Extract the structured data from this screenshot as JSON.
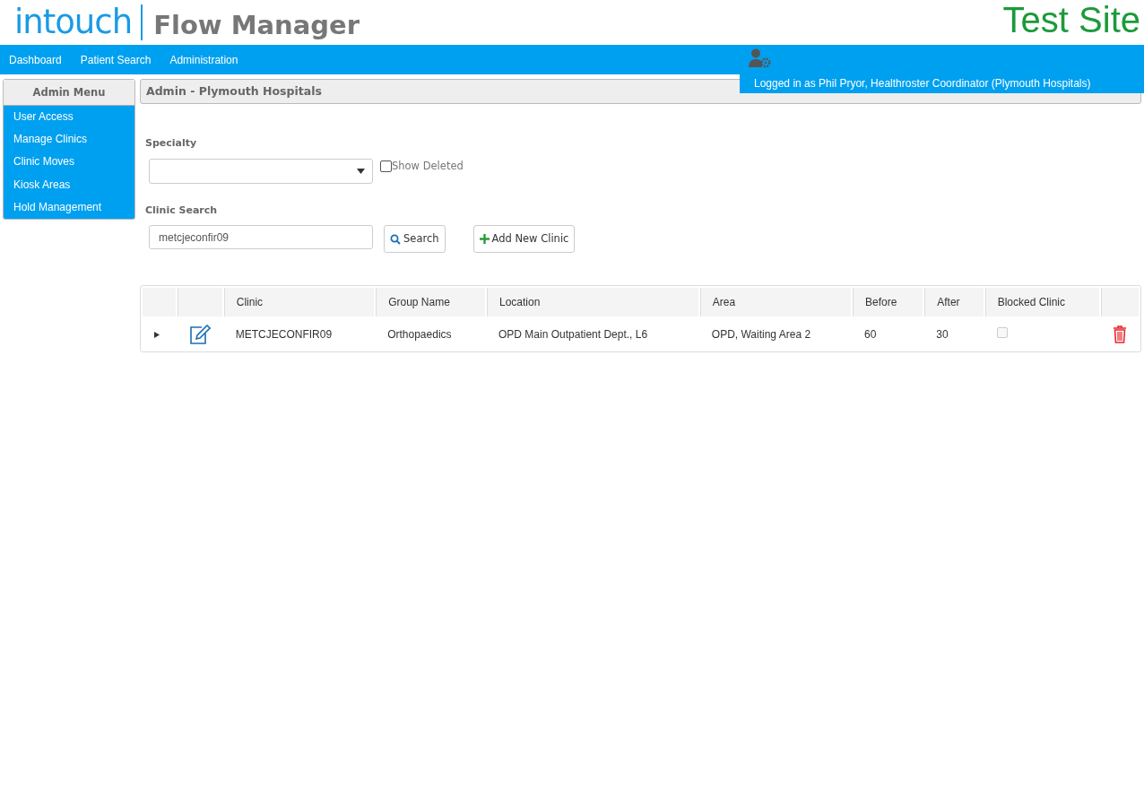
{
  "header": {
    "logo_primary": "intouch",
    "logo_secondary": "Flow Manager",
    "site_label": "Test Site"
  },
  "nav": {
    "items": [
      {
        "label": "Dashboard"
      },
      {
        "label": "Patient Search"
      },
      {
        "label": "Administration"
      }
    ],
    "user_banner": "Logged in as Phil Pryor, Healthroster Coordinator (Plymouth Hospitals)"
  },
  "sidebar": {
    "title": "Admin Menu",
    "items": [
      {
        "label": "User Access"
      },
      {
        "label": "Manage Clinics"
      },
      {
        "label": "Clinic Moves"
      },
      {
        "label": "Kiosk Areas"
      },
      {
        "label": "Hold Management"
      }
    ]
  },
  "panel": {
    "title": "Admin - Plymouth Hospitals"
  },
  "filters": {
    "specialty_label": "Specialty",
    "show_deleted": {
      "label": "Show Deleted",
      "checked": false
    },
    "search_label": "Clinic Search",
    "search_value": "metcjeconfir09",
    "search_button": "Search",
    "add_button": "Add New Clinic"
  },
  "table": {
    "columns": [
      "",
      "",
      "Clinic",
      "Group Name",
      "Location",
      "Area",
      "Before",
      "After",
      "Blocked Clinic",
      ""
    ],
    "rows": [
      {
        "expanded": false,
        "clinic": "METCJECONFIR09",
        "group_name": "Orthopaedics",
        "location": "OPD Main Outpatient Dept., L6",
        "area": "OPD, Waiting Area 2",
        "before": "60",
        "after": "30",
        "blocked": false
      }
    ]
  }
}
